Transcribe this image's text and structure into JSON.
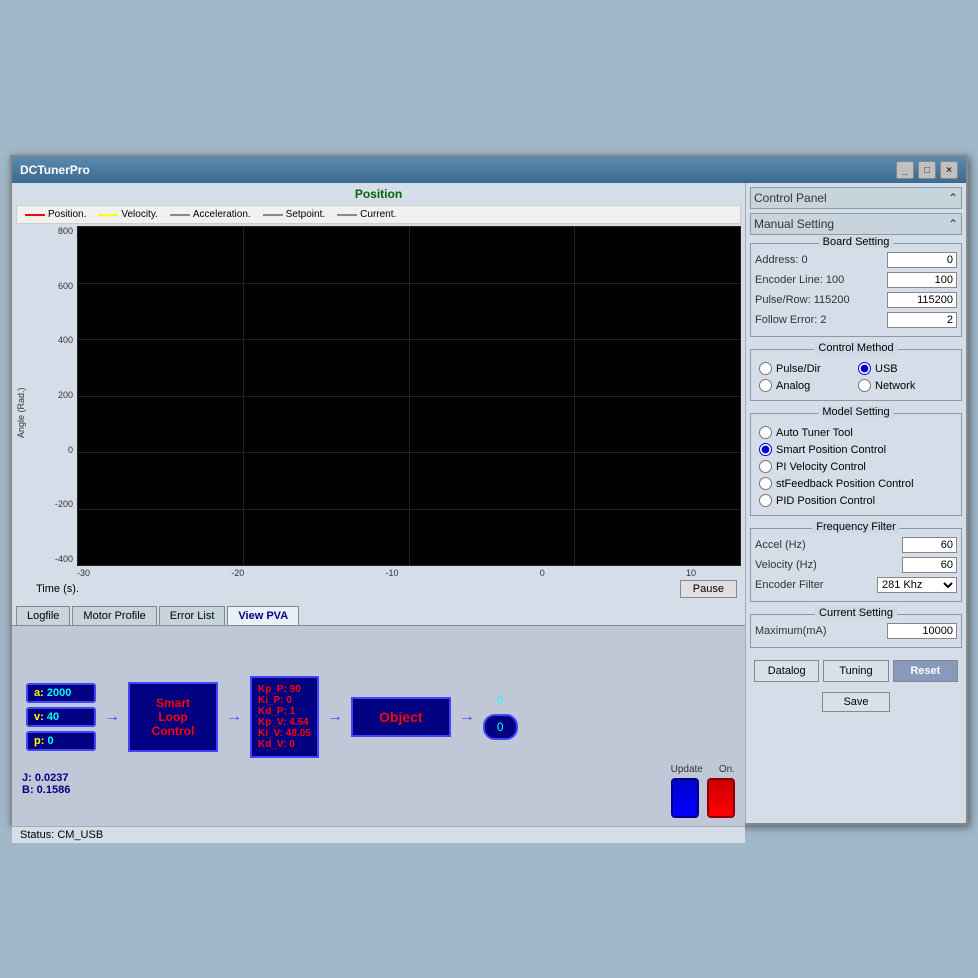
{
  "window": {
    "title": "DCTunerPro",
    "minimize_label": "_",
    "maximize_label": "□",
    "close_label": "×"
  },
  "chart": {
    "title": "Position",
    "legend": [
      {
        "label": "Position.",
        "color": "#ff0000"
      },
      {
        "label": "Velocity.",
        "color": "#ffff00"
      },
      {
        "label": "Acceleration.",
        "color": "#888888"
      },
      {
        "label": "Setpoint.",
        "color": "#888888"
      },
      {
        "label": "Current.",
        "color": "#888888"
      }
    ],
    "y_axis": [
      "800",
      "600",
      "400",
      "200",
      "0",
      "-200",
      "-400"
    ],
    "x_axis": [
      "-30",
      "-20",
      "-10",
      "0",
      "10"
    ],
    "y_title": "Angle (Rad.)",
    "x_title": "Time (s).",
    "pause_label": "Pause"
  },
  "tabs": [
    {
      "label": "Logfile",
      "active": false
    },
    {
      "label": "Motor Profile",
      "active": false
    },
    {
      "label": "Error List",
      "active": false
    },
    {
      "label": "View PVA",
      "active": true
    }
  ],
  "control_loop": {
    "a_label": "a:",
    "a_value": "2000",
    "v_label": "v:",
    "v_value": "40",
    "p_label": "p:",
    "p_value": "0",
    "j_label": "J:",
    "j_value": "0.0237",
    "b_label": "B:",
    "b_value": "0.1586",
    "smart_loop_label": "Smart Loop Control",
    "kp_p": "Kp_P:  90",
    "ki_p": "Ki_P:  0",
    "kd_p": "Kd_P:  1",
    "kp_v": "Kp_V:  4.54",
    "ki_v": "Ki_V:  48.05",
    "kd_v": "Kd_V:  0",
    "object_label": "Object",
    "output_top": "0",
    "output_bottom": "0",
    "update_label": "Update",
    "on_label": "On."
  },
  "status": {
    "label": "Status:",
    "value": "CM_USB"
  },
  "right_panel": {
    "header": "Control Panel",
    "manual_setting": "Manual Setting",
    "board_setting": "Board Setting",
    "address_label": "Address: 0",
    "address_value": "0",
    "encoder_label": "Encoder Line: 100",
    "encoder_value": "100",
    "pulse_label": "Pulse/Row: 115200",
    "pulse_value": "115200",
    "follow_label": "Follow Error: 2",
    "follow_value": "2",
    "control_method": "Control Method",
    "pulse_dir": "Pulse/Dir",
    "usb": "USB",
    "analog": "Analog",
    "network": "Network",
    "model_setting": "Model Setting",
    "auto_tuner": "Auto Tuner Tool",
    "smart_position": "Smart Position Control",
    "pi_velocity": "PI Velocity Control",
    "st_feedback": "stFeedback Position Control",
    "pid_position": "PID Position Control",
    "frequency_filter": "Frequency Filter",
    "accel_label": "Accel (Hz)",
    "accel_value": "60",
    "velocity_label": "Velocity (Hz)",
    "velocity_value": "60",
    "encoder_filter_label": "Encoder Filter",
    "encoder_filter_value": "281 Khz",
    "current_setting": "Current Setting",
    "maximum_label": "Maximum(mA)",
    "maximum_value": "10000",
    "datalog_label": "Datalog",
    "tuning_label": "Tuning",
    "reset_label": "Reset",
    "save_label": "Save"
  }
}
